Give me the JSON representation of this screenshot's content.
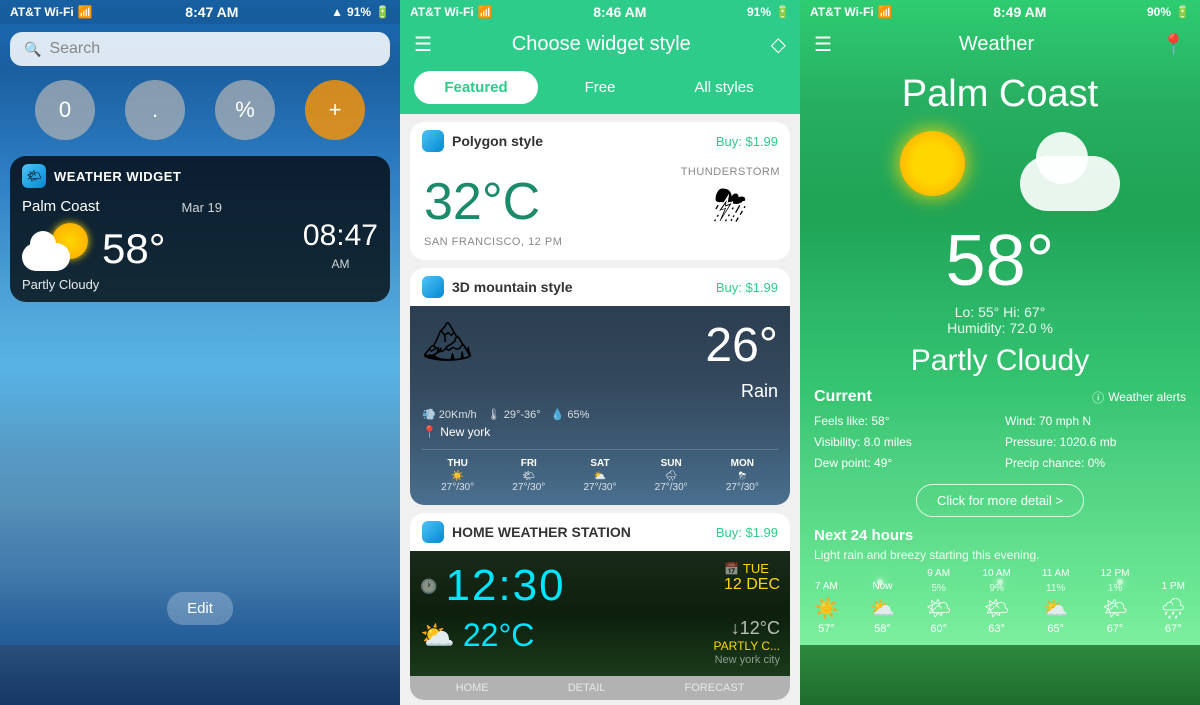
{
  "panel1": {
    "status": {
      "carrier": "AT&T Wi-Fi",
      "wifi": "📶",
      "time": "8:47 AM",
      "gps": "▲",
      "battery": "91%"
    },
    "search": {
      "placeholder": "Search"
    },
    "calculator": {
      "buttons": [
        "0",
        ".",
        "%",
        "+"
      ]
    },
    "widget": {
      "title": "WEATHER WIDGET",
      "location": "Palm Coast",
      "date": "Mar 19",
      "temperature": "58°",
      "condition": "Partly Cloudy",
      "time": "08:47",
      "ampm": "AM"
    },
    "edit_button": "Edit"
  },
  "panel2": {
    "status": {
      "carrier": "AT&T Wi-Fi",
      "time": "8:46 AM",
      "battery": "91%"
    },
    "header": {
      "title": "Choose widget style",
      "menu_icon": "☰",
      "diamond_icon": "◇"
    },
    "tabs": [
      {
        "label": "Featured",
        "active": true
      },
      {
        "label": "Free",
        "active": false
      },
      {
        "label": "All styles",
        "active": false
      }
    ],
    "cards": [
      {
        "name": "Polygon style",
        "price": "Buy: $1.99",
        "preview": {
          "temp": "32°C",
          "weather": "THUNDERSTORM",
          "city": "SAN FRANCISCO, 12 PM"
        }
      },
      {
        "name": "3D mountain style",
        "price": "Buy: $1.99",
        "preview": {
          "temp": "26°",
          "condition": "Rain",
          "wind": "20Km/h",
          "temp_range": "29°-36°",
          "humidity": "65%",
          "location": "New york",
          "forecast": [
            {
              "day": "THU",
              "temp": "27°/30°"
            },
            {
              "day": "FRI",
              "temp": "27°/30°"
            },
            {
              "day": "SAT",
              "temp": "27°/30°"
            },
            {
              "day": "SUN",
              "temp": "27°/30°"
            },
            {
              "day": "MON",
              "temp": "27°/30°"
            }
          ]
        }
      },
      {
        "name": "HOME WEATHER STATION",
        "price": "Buy: $1.99",
        "preview": {
          "time": "12:30",
          "date": "12 DEC",
          "day": "TUE",
          "temp": "22°C",
          "feels_like": "↓12°C",
          "condition": "PARTLY C...",
          "city": "New york city"
        }
      }
    ]
  },
  "panel3": {
    "status": {
      "carrier": "AT&T Wi-Fi",
      "time": "8:49 AM",
      "battery": "90%"
    },
    "header": {
      "title": "Weather",
      "menu_icon": "☰",
      "location_icon": "📍"
    },
    "city": "Palm Coast",
    "temperature": "58°",
    "lo": "55°",
    "hi": "67°",
    "humidity": "72.0 %",
    "condition": "Partly Cloudy",
    "current": {
      "label": "Current",
      "alerts_label": "Weather alerts",
      "feels_like": "Feels like: 58°",
      "visibility": "Visibility: 8.0 miles",
      "dew_point": "Dew point: 49°",
      "wind": "Wind: 70 mph N",
      "pressure": "Pressure: 1020.6 mb",
      "precip": "Precip chance: 0%"
    },
    "detail_button": "Click for more detail >",
    "next24": {
      "label": "Next 24 hours",
      "note": "Light rain and breezy starting this evening.",
      "hours": [
        {
          "label": "7 AM",
          "pct": "",
          "icon": "☀️",
          "temp": "57°"
        },
        {
          "label": "Now",
          "pct": "",
          "icon": "⛅",
          "temp": "58°"
        },
        {
          "label": "9 AM",
          "pct": "5%",
          "icon": "🌤",
          "temp": "60°"
        },
        {
          "label": "10 AM",
          "pct": "9%",
          "icon": "🌤",
          "temp": "63°"
        },
        {
          "label": "11 AM",
          "pct": "11%",
          "icon": "⛅",
          "temp": "65°"
        },
        {
          "label": "12 PM",
          "pct": "1%",
          "icon": "🌤",
          "temp": "67°"
        },
        {
          "label": "1 PM",
          "pct": "",
          "icon": "🌧",
          "temp": "67°"
        }
      ]
    }
  }
}
